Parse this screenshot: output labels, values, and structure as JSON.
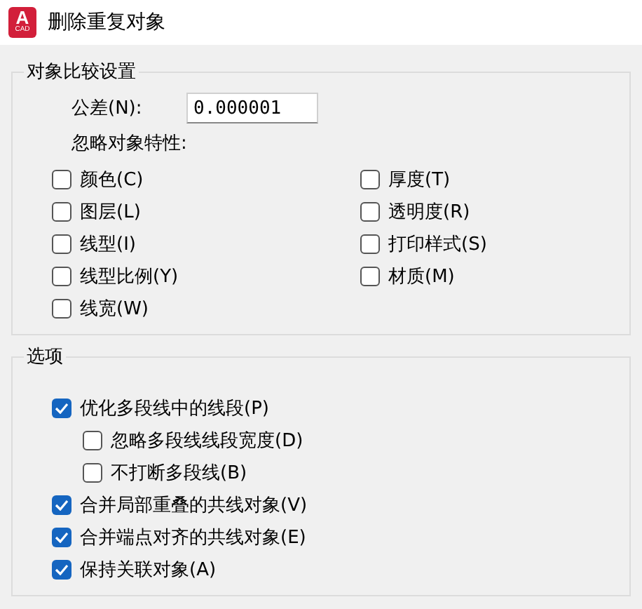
{
  "window": {
    "title": "删除重复对象",
    "icon": {
      "letter": "A",
      "caption": "CAD"
    }
  },
  "comparison": {
    "title": "对象比较设置",
    "tolerance": {
      "label": "公差(N):",
      "value": "0.000001"
    },
    "ignore_label": "忽略对象特性:",
    "properties": [
      {
        "label": "颜色(C)",
        "checked": false
      },
      {
        "label": "厚度(T)",
        "checked": false
      },
      {
        "label": "图层(L)",
        "checked": false
      },
      {
        "label": "透明度(R)",
        "checked": false
      },
      {
        "label": "线型(I)",
        "checked": false
      },
      {
        "label": "打印样式(S)",
        "checked": false
      },
      {
        "label": "线型比例(Y)",
        "checked": false
      },
      {
        "label": "材质(M)",
        "checked": false
      },
      {
        "label": "线宽(W)",
        "checked": false
      }
    ]
  },
  "options": {
    "title": "选项",
    "items": [
      {
        "label": "优化多段线中的线段(P)",
        "checked": true,
        "children": [
          {
            "label": "忽略多段线线段宽度(D)",
            "checked": false
          },
          {
            "label": "不打断多段线(B)",
            "checked": false
          }
        ]
      },
      {
        "label": "合并局部重叠的共线对象(V)",
        "checked": true
      },
      {
        "label": "合并端点对齐的共线对象(E)",
        "checked": true
      },
      {
        "label": "保持关联对象(A)",
        "checked": true
      }
    ]
  }
}
